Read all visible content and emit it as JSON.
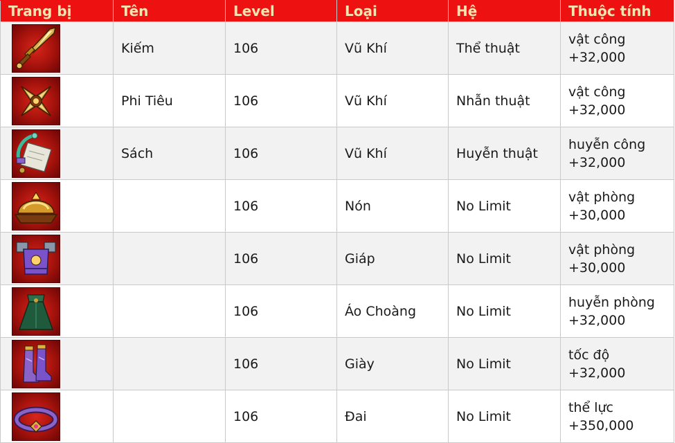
{
  "headers": {
    "equip": "Trang bị",
    "name": "Tên",
    "level": "Level",
    "type": "Loại",
    "system": "Hệ",
    "attribute": "Thuộc tính"
  },
  "rows": [
    {
      "icon": "sword-icon",
      "name": "Kiếm",
      "level": "106",
      "type": "Vũ Khí",
      "system": "Thể thuật",
      "attr_stat": "vật công",
      "attr_value": "+32,000"
    },
    {
      "icon": "shuriken-icon",
      "name": "Phi Tiêu",
      "level": "106",
      "type": "Vũ Khí",
      "system": "Nhẫn thuật",
      "attr_stat": "vật công",
      "attr_value": "+32,000"
    },
    {
      "icon": "scroll-book-icon",
      "name": "Sách",
      "level": "106",
      "type": "Vũ Khí",
      "system": "Huyễn thuật",
      "attr_stat": "huyễn công",
      "attr_value": "+32,000"
    },
    {
      "icon": "helmet-icon",
      "name": "",
      "level": "106",
      "type": "Nón",
      "system": "No Limit",
      "attr_stat": "vật phòng",
      "attr_value": "+30,000"
    },
    {
      "icon": "armor-icon",
      "name": "",
      "level": "106",
      "type": "Giáp",
      "system": "No Limit",
      "attr_stat": "vật phòng",
      "attr_value": "+30,000"
    },
    {
      "icon": "cloak-icon",
      "name": "",
      "level": "106",
      "type": "Áo Choàng",
      "system": "No Limit",
      "attr_stat": "huyễn phòng",
      "attr_value": "+32,000"
    },
    {
      "icon": "boots-icon",
      "name": "",
      "level": "106",
      "type": "Giày",
      "system": "No Limit",
      "attr_stat": "tốc độ",
      "attr_value": "+32,000"
    },
    {
      "icon": "belt-icon",
      "name": "",
      "level": "106",
      "type": "Đai",
      "system": "No Limit",
      "attr_stat": "thể lực",
      "attr_value": "+350,000"
    }
  ],
  "colors": {
    "header_bg": "#ee1111",
    "header_text": "#f6e3b0",
    "row_alt_bg": "#f2f2f2",
    "border": "#c9c9c9"
  }
}
